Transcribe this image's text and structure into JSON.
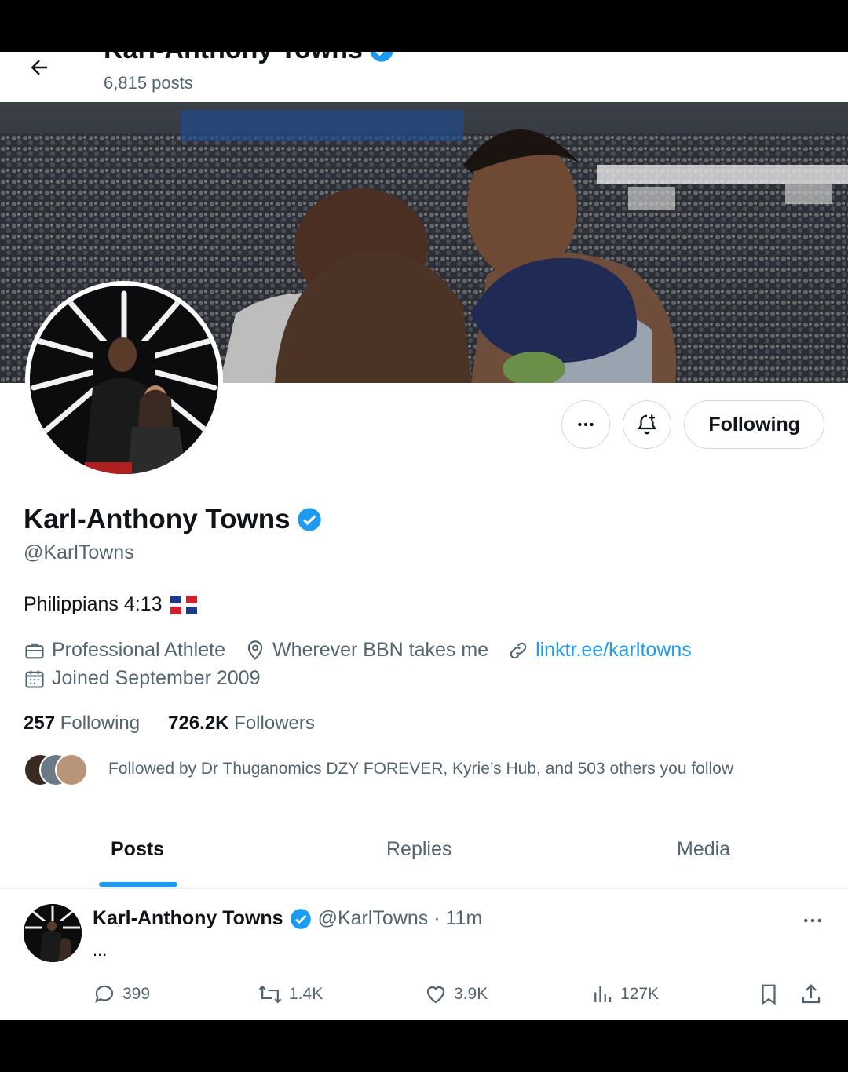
{
  "header": {
    "title": "Karl-Anthony Towns",
    "posts_count": "6,815 posts"
  },
  "actions": {
    "following_label": "Following"
  },
  "profile": {
    "name": "Karl-Anthony Towns",
    "handle": "@KarlTowns",
    "bio": "Philippians 4:13",
    "occupation": "Professional Athlete",
    "location": "Wherever BBN takes me",
    "link": "linktr.ee/karltowns",
    "joined": "Joined September 2009",
    "following_count": "257",
    "following_label": "Following",
    "followers_count": "726.2K",
    "followers_label": "Followers",
    "followed_by": "Followed by Dr Thuganomics DZY FOREVER, Kyrie’s Hub, and 503 others you follow"
  },
  "tabs": [
    {
      "label": "Posts"
    },
    {
      "label": "Replies"
    },
    {
      "label": "Media"
    }
  ],
  "post": {
    "author": "Karl-Anthony Towns",
    "handle_time": "@KarlTowns · 11m",
    "body": "...",
    "replies": "399",
    "reposts": "1.4K",
    "likes": "3.9K",
    "views": "127K"
  },
  "colors": {
    "accent": "#1d9bf0",
    "text": "#0f1419",
    "muted": "#536471"
  }
}
